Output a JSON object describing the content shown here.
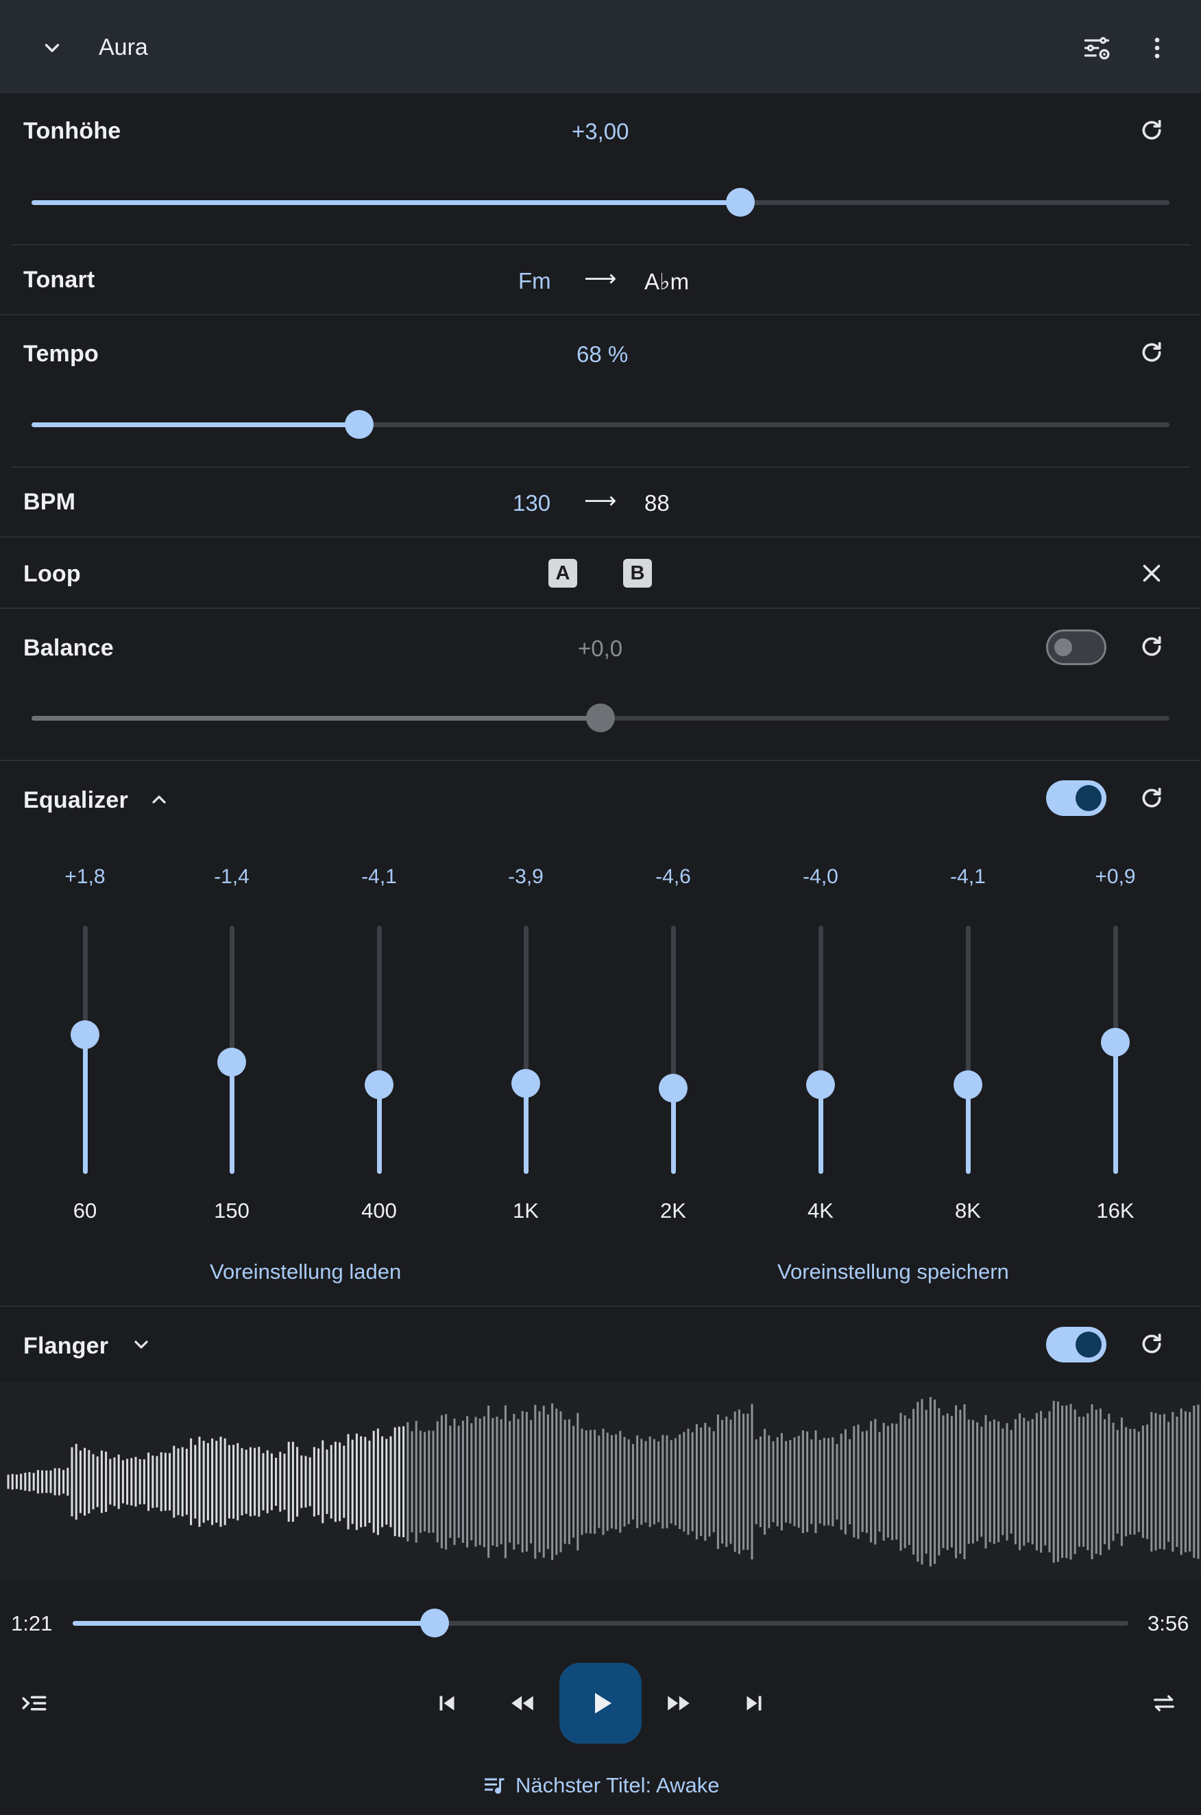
{
  "header": {
    "title": "Aura",
    "collapse_icon": "chevron-down-icon",
    "settings_icon": "tune-settings-icon",
    "menu_icon": "more-vert-icon"
  },
  "pitch": {
    "label": "Tonhöhe",
    "value": "+3,00",
    "level": 0.623
  },
  "key": {
    "label": "Tonart",
    "from": "Fm",
    "arrow": "⟶",
    "to": "A♭m"
  },
  "tempo": {
    "label": "Tempo",
    "value": "68 %",
    "level": 0.288
  },
  "bpm": {
    "label": "BPM",
    "from": "130",
    "arrow": "⟶",
    "to": "88"
  },
  "loop": {
    "label": "Loop",
    "a": "A",
    "b": "B"
  },
  "balance": {
    "label": "Balance",
    "value": "+0,0",
    "enabled": false,
    "level": 0.5
  },
  "equalizer": {
    "label": "Equalizer",
    "enabled": true,
    "bands": [
      {
        "freq": "60",
        "value": "+1,8",
        "level": 0.56
      },
      {
        "freq": "150",
        "value": "-1,4",
        "level": 0.45
      },
      {
        "freq": "400",
        "value": "-4,1",
        "level": 0.36
      },
      {
        "freq": "1K",
        "value": "-3,9",
        "level": 0.365
      },
      {
        "freq": "2K",
        "value": "-4,6",
        "level": 0.345
      },
      {
        "freq": "4K",
        "value": "-4,0",
        "level": 0.36
      },
      {
        "freq": "8K",
        "value": "-4,1",
        "level": 0.36
      },
      {
        "freq": "16K",
        "value": "+0,9",
        "level": 0.53
      }
    ],
    "load_preset": "Voreinstellung laden",
    "save_preset": "Voreinstellung speichern"
  },
  "flanger": {
    "label": "Flanger",
    "enabled": true
  },
  "player": {
    "elapsed": "1:21",
    "total": "3:56",
    "progress": 0.343,
    "next_track": "Nächster Titel: Awake"
  },
  "colors": {
    "accent": "#a9ccf8",
    "background": "#1b1c1f",
    "header": "#262a31",
    "play": "#0f4a7a"
  }
}
